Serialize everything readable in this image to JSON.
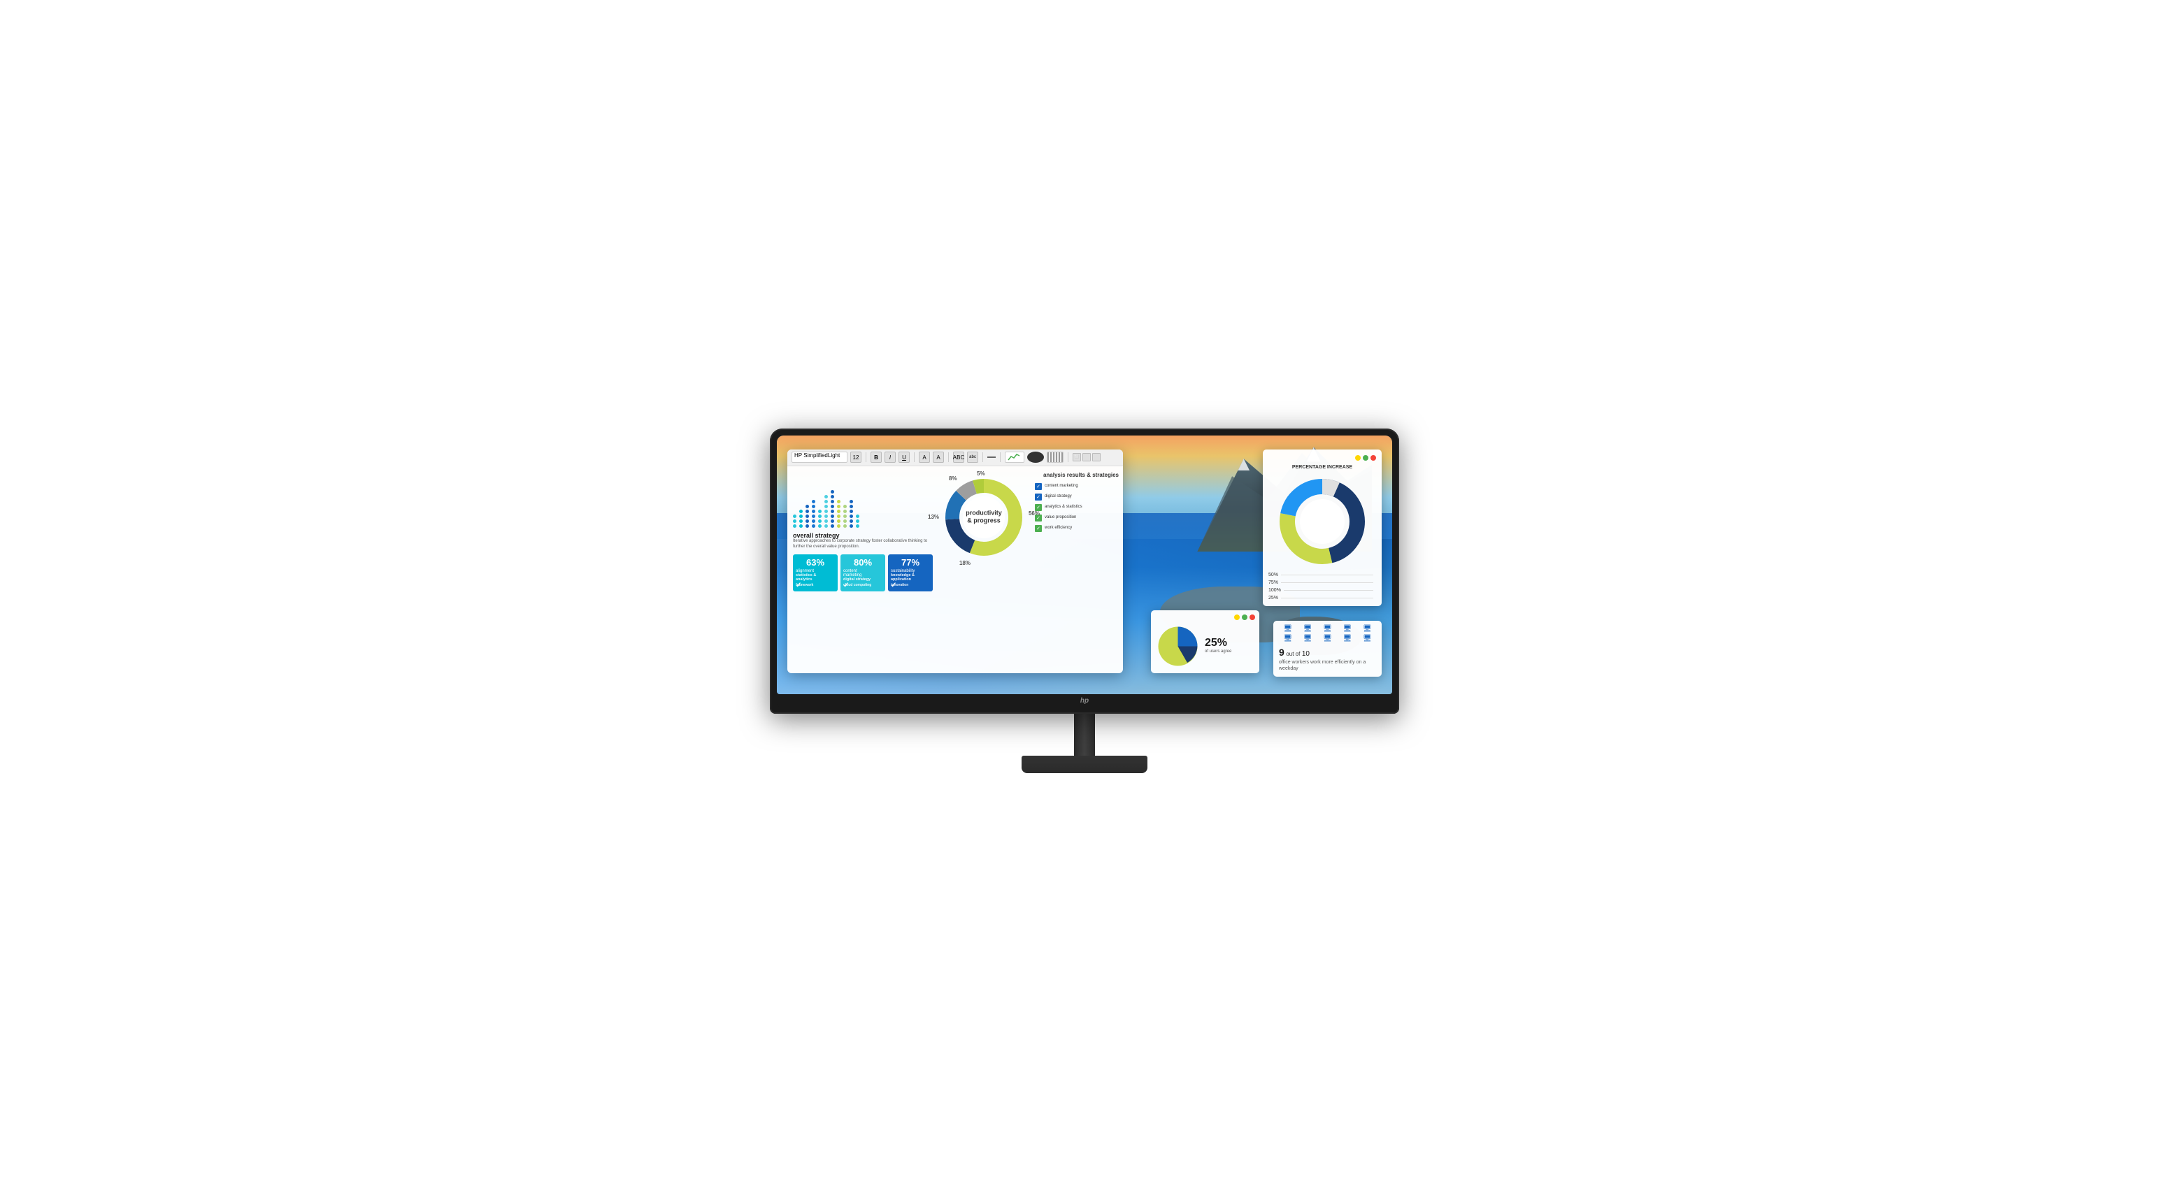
{
  "monitor": {
    "brand": "hp",
    "hp_logo": "hp"
  },
  "toolbar": {
    "font_name": "HP SimplifiedLight",
    "font_size": "12",
    "bold": "B",
    "italic": "I",
    "underline": "U",
    "text_a": "A",
    "text_a2": "A",
    "abc": "ABC",
    "abc2": "abc"
  },
  "dashboard": {
    "overall_strategy": {
      "title": "overall strategy",
      "description": "Iterative approaches to corporate strategy foster collaborative thinking to further the overall value proposition."
    },
    "stats": [
      {
        "value": "63%",
        "label": "alignment",
        "sub1": "statistics &",
        "sub2": "analytics",
        "sub3": "framework",
        "color": "cyan"
      },
      {
        "value": "80%",
        "label": "content marketing",
        "sub1": "digital strategy",
        "sub2": "cloud computing",
        "color": "teal"
      },
      {
        "value": "77%",
        "label": "sustainability",
        "sub1": "knowledge &",
        "sub2": "application",
        "sub3": "innovation",
        "color": "blue"
      }
    ],
    "donut": {
      "center_label": "productivity",
      "center_label2": "& progress",
      "segments": [
        {
          "value": "56%",
          "color": "#c8d84a",
          "angle": 0,
          "sweep": 201
        },
        {
          "value": "18%",
          "color": "#1a3a6c",
          "angle": 201,
          "sweep": 65
        },
        {
          "value": "13%",
          "color": "#2171b5",
          "angle": 266,
          "sweep": 47
        },
        {
          "value": "8%",
          "color": "#9e9e9e",
          "angle": 313,
          "sweep": 29
        },
        {
          "value": "5%",
          "color": "#b0cc3a",
          "angle": 342,
          "sweep": 18
        }
      ]
    },
    "analysis": {
      "title": "analysis results & strategies",
      "items": [
        {
          "label": "content marketing",
          "checked": true
        },
        {
          "label": "digital strategy",
          "checked": true
        },
        {
          "label": "analytics & statistics",
          "checked": true
        },
        {
          "label": "value proposition",
          "checked": true
        },
        {
          "label": "work efficiency",
          "checked": true
        }
      ]
    }
  },
  "panel_percentage": {
    "title": "PERCENTAGE INCREASE",
    "values": [
      {
        "label": "50%"
      },
      {
        "label": "75%"
      },
      {
        "label": "100%"
      },
      {
        "label": "25%"
      }
    ],
    "donut": {
      "segments": [
        {
          "color": "#1a3a6c",
          "sweep": 130
        },
        {
          "color": "#c8d84a",
          "sweep": 90
        },
        {
          "color": "#2196f3",
          "sweep": 80
        },
        {
          "color": "#e0e0e0",
          "sweep": 60
        }
      ]
    }
  },
  "panel_pie": {
    "percent": "25%",
    "sub_text": "of users agree"
  },
  "panel_computers": {
    "stat_big": "9",
    "stat_out_of": "10",
    "stat_text": "office workers work more efficiently on a weekday",
    "computer_count": 10
  }
}
